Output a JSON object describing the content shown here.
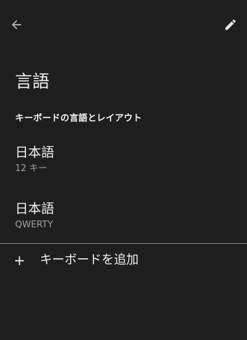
{
  "appbar": {
    "back_icon": "arrow-left-icon",
    "edit_icon": "pencil-icon"
  },
  "page": {
    "title": "言語"
  },
  "section": {
    "header": "キーボードの言語とレイアウト"
  },
  "languages": [
    {
      "name": "日本語",
      "layout": "12 キー"
    },
    {
      "name": "日本語",
      "layout": "QWERTY"
    }
  ],
  "add_keyboard": {
    "plus": "+",
    "label": "キーボードを追加"
  },
  "colors": {
    "background": "#1e1e1e",
    "text_primary": "#f1f1f1",
    "text_secondary": "#a0a0a0",
    "divider": "#8a8a8a"
  }
}
